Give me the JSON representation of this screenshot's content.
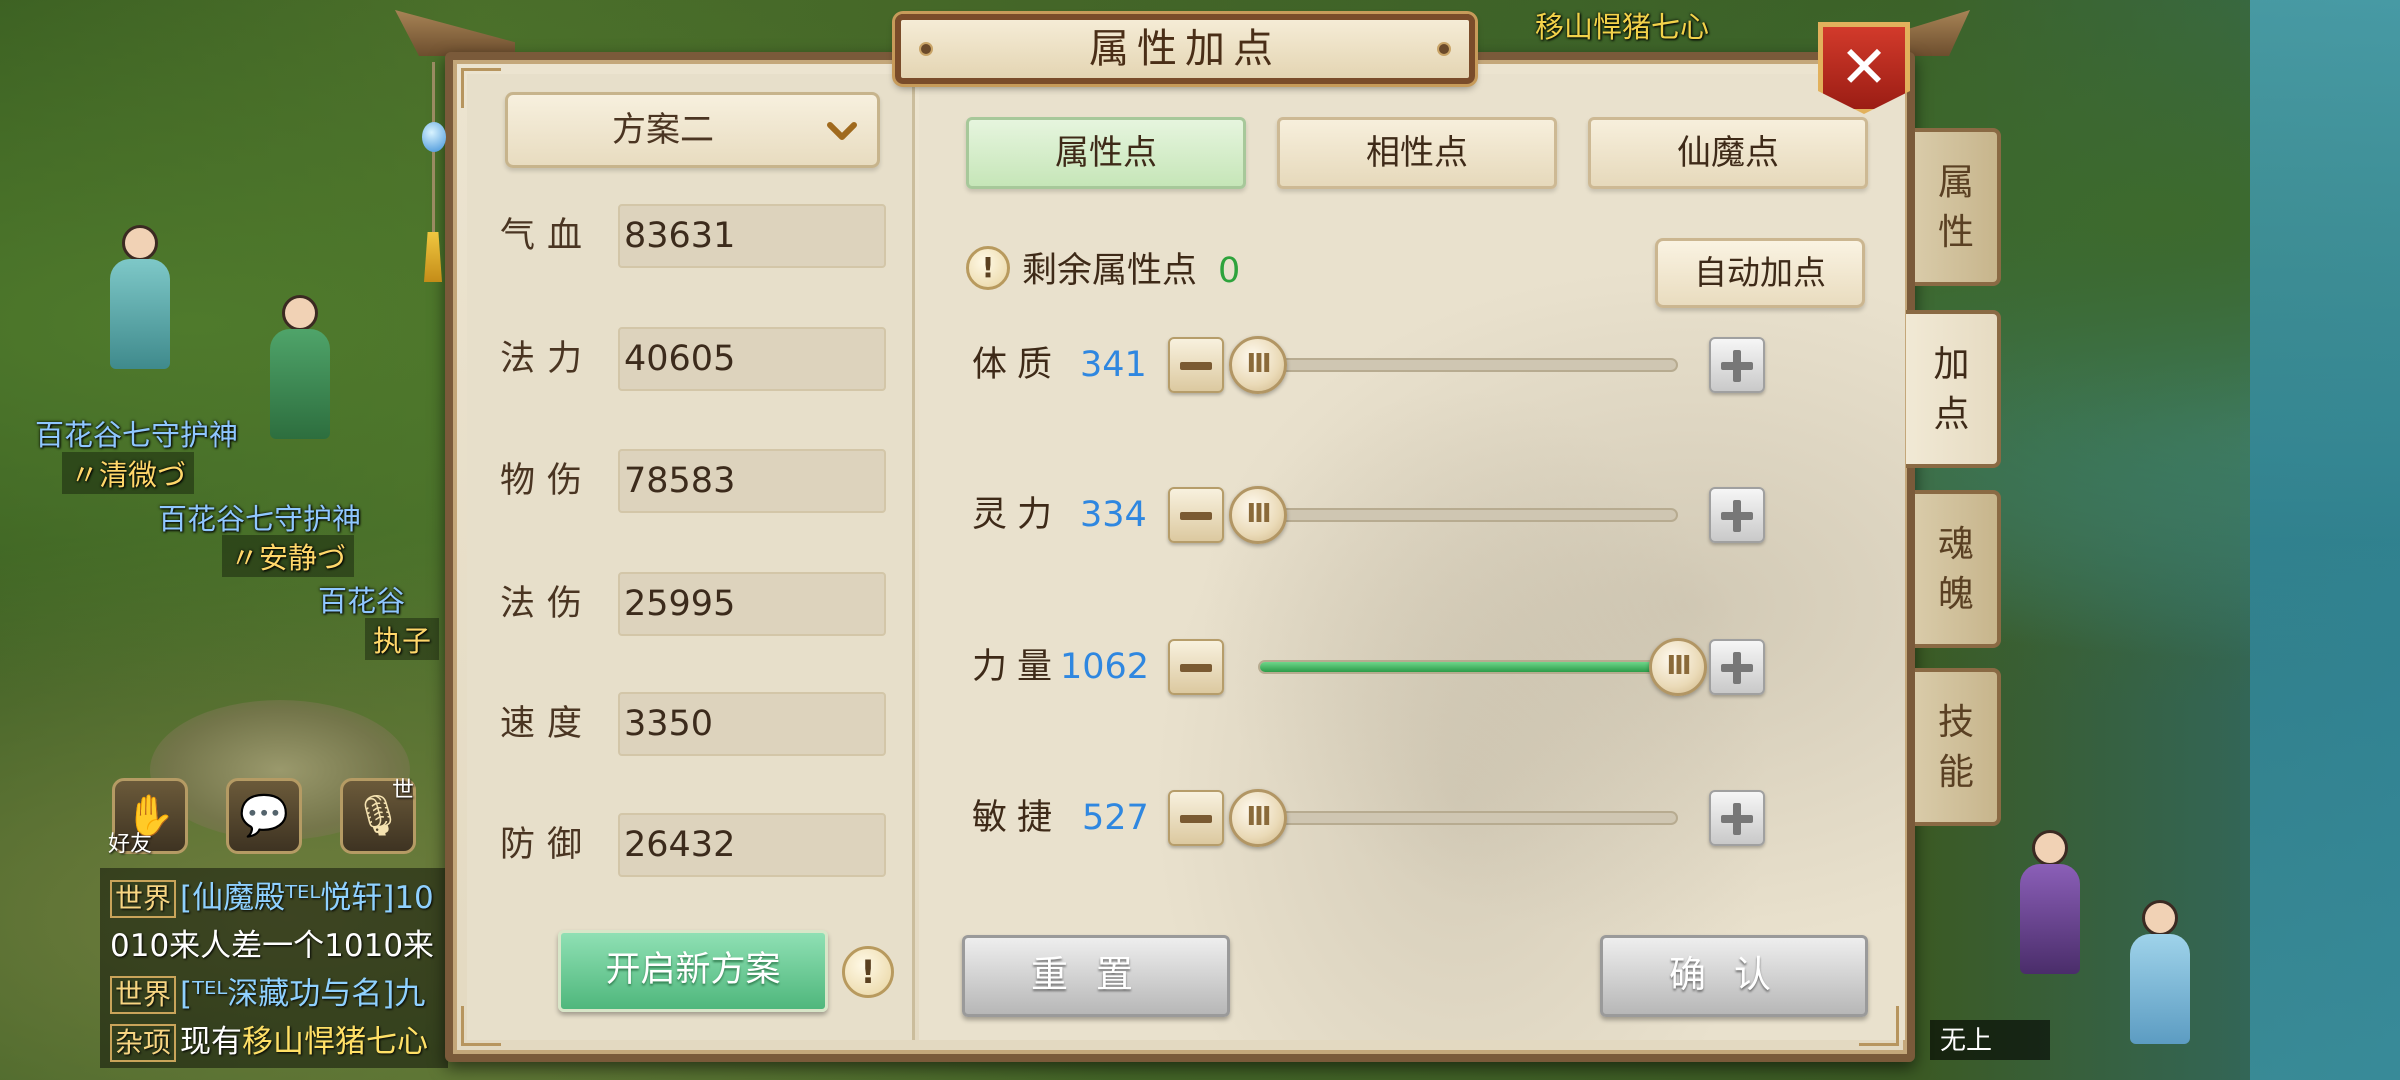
{
  "panel": {
    "title": "属性加点",
    "close_glyph": "✕"
  },
  "background": {
    "top_tag": "移山悍猪七心",
    "guild_tag_1": "百花谷七守护神",
    "player_1": "〃清微づ",
    "guild_tag_2": "百花谷七守护神",
    "player_2": "〃安静づ",
    "guild_tag_3": "百花谷",
    "player_3": "执子",
    "bottom_right_text": "无上"
  },
  "social": {
    "friends_label": "好友",
    "world_badge": "世"
  },
  "chat": {
    "lines": [
      {
        "channel": "世界",
        "text": "[仙魔殿ᵀᴱᴸ悦轩]10"
      },
      {
        "channel": "",
        "text": "010来人差一个1010来"
      },
      {
        "channel": "世界",
        "text": "[ᵀᴱᴸ深藏功与名]九"
      },
      {
        "channel": "杂项",
        "text_prefix": "现有",
        "text_highlight": "移山悍猪七心"
      }
    ]
  },
  "plan": {
    "selected": "方案二",
    "new_plan_button": "开启新方案",
    "info_glyph": "!"
  },
  "stats": [
    {
      "label": "气血",
      "value": "83631"
    },
    {
      "label": "法力",
      "value": "40605"
    },
    {
      "label": "物伤",
      "value": "78583"
    },
    {
      "label": "法伤",
      "value": "25995"
    },
    {
      "label": "速度",
      "value": "3350"
    },
    {
      "label": "防御",
      "value": "26432"
    }
  ],
  "tabs": [
    {
      "label": "属性点",
      "active": true
    },
    {
      "label": "相性点",
      "active": false
    },
    {
      "label": "仙魔点",
      "active": false
    }
  ],
  "remaining": {
    "label": "剩余属性点",
    "value": "0",
    "info_glyph": "!"
  },
  "auto_button": "自动加点",
  "attributes": [
    {
      "label": "体质",
      "value": "341",
      "slider_fraction": 0.0
    },
    {
      "label": "灵力",
      "value": "334",
      "slider_fraction": 0.0
    },
    {
      "label": "力量",
      "value": "1062",
      "slider_fraction": 1.0
    },
    {
      "label": "敏捷",
      "value": "527",
      "slider_fraction": 0.0
    }
  ],
  "thumb_glyph": "III",
  "reset_button": "重置",
  "confirm_button": "确认",
  "side_tabs": [
    {
      "label_1": "属",
      "label_2": "性",
      "active": false
    },
    {
      "label_1": "加",
      "label_2": "点",
      "active": true
    },
    {
      "label_1": "魂",
      "label_2": "魄",
      "active": false
    },
    {
      "label_1": "技",
      "label_2": "能",
      "active": false
    }
  ],
  "colors": {
    "attr_value": "#2f87e0",
    "remaining_value": "#2ea33c",
    "slider_fill": "#2c9c49",
    "close_red": "#d23a2b"
  }
}
